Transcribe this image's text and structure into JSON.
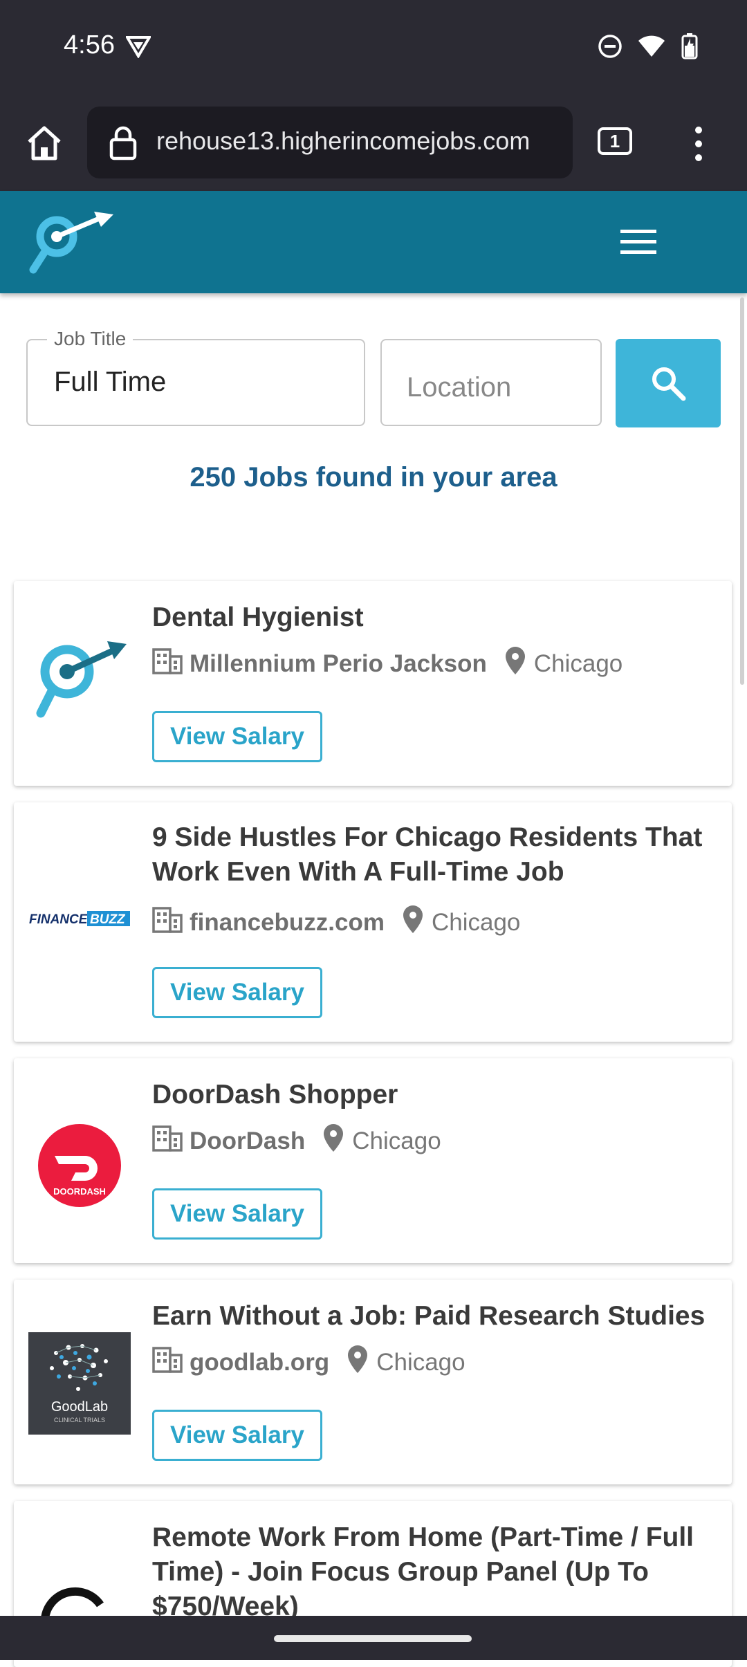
{
  "status": {
    "time": "4:56"
  },
  "browser": {
    "url": "rehouse13.higherincomejobs.com",
    "tab_count": "1"
  },
  "search": {
    "job_title_label": "Job Title",
    "job_title_value": "Full Time",
    "location_placeholder": "Location"
  },
  "results_count": "250 Jobs found in your area",
  "jobs": [
    {
      "title": "Dental Hygienist",
      "company": "Millennium Perio Jackson",
      "city": "Chicago",
      "button": "View Salary"
    },
    {
      "title": "9 Side Hustles For Chicago Residents That Work Even With A Full-Time Job",
      "company": "financebuzz.com",
      "city": "Chicago",
      "button": "View Salary",
      "logo_text_a": "FINANCE",
      "logo_text_b": "BUZZ"
    },
    {
      "title": "DoorDash Shopper",
      "company": "DoorDash",
      "city": "Chicago",
      "button": "View Salary",
      "logo_text": "DOORDASH"
    },
    {
      "title": "Earn Without a Job: Paid Research Studies",
      "company": "goodlab.org",
      "city": "Chicago",
      "button": "View Salary",
      "logo_text_a": "GoodLab",
      "logo_text_b": "CLINICAL TRIALS"
    },
    {
      "title": "Remote Work From Home (Part-Time / Full Time) - Join Focus Group Panel (Up To $750/Week)"
    }
  ],
  "colors": {
    "header": "#0f7390",
    "accent": "#3eb5d9",
    "count_text": "#1d5f8c"
  }
}
